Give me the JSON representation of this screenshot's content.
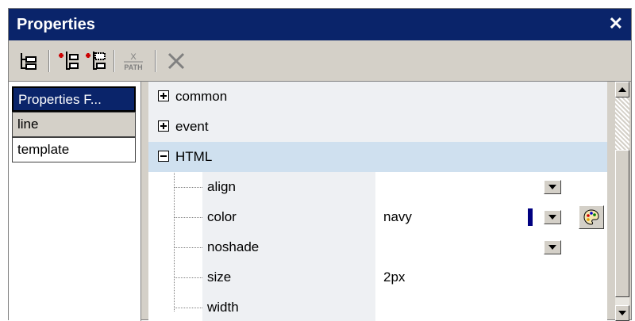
{
  "window": {
    "title": "Properties",
    "close_symbol": "✕"
  },
  "toolbar": {
    "buttons": [
      {
        "icon": "add-sibling-tree-icon"
      },
      {
        "icon": "insert-child-icon"
      },
      {
        "icon": "insert-attribute-icon"
      },
      {
        "icon": "xpath-icon",
        "top_label": "X",
        "bottom_label": "PATH"
      },
      {
        "icon": "delete-icon"
      }
    ]
  },
  "left_panel": {
    "items": [
      {
        "label": "Properties F...",
        "selected": true
      },
      {
        "label": "line",
        "selected": false
      },
      {
        "label": "template",
        "selected": false
      }
    ]
  },
  "groups": [
    {
      "label": "common",
      "expanded": false
    },
    {
      "label": "event",
      "expanded": false
    },
    {
      "label": "HTML",
      "expanded": true
    }
  ],
  "properties": [
    {
      "name": "align",
      "value": "",
      "has_dropdown": true
    },
    {
      "name": "color",
      "value": "navy",
      "has_dropdown": true,
      "swatch_color": "#000080",
      "has_palette": true
    },
    {
      "name": "noshade",
      "value": "",
      "has_dropdown": true
    },
    {
      "name": "size",
      "value": "2px",
      "has_dropdown": false
    },
    {
      "name": "width",
      "value": "",
      "has_dropdown": false
    }
  ],
  "colors": {
    "titlebar": "#0a246a",
    "group_row": "#eef0f3",
    "highlight_row": "#cfe0ef",
    "swatch_navy": "#000080"
  }
}
